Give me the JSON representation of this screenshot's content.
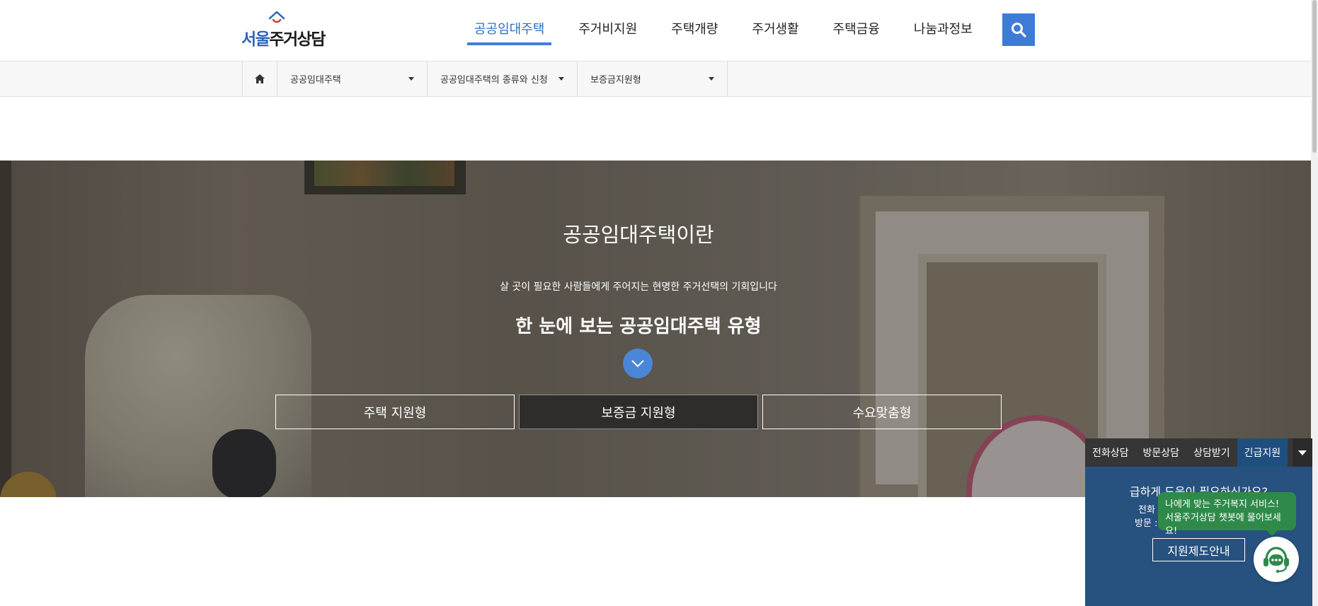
{
  "header": {
    "logo_text_part1": "서울",
    "logo_text_part2": "주거상담",
    "nav": [
      {
        "label": "공공임대주택",
        "active": true
      },
      {
        "label": "주거비지원"
      },
      {
        "label": "주택개량"
      },
      {
        "label": "주거생활"
      },
      {
        "label": "주택금융"
      },
      {
        "label": "나눔과정보"
      }
    ],
    "search_icon": "search-icon",
    "accent_color": "#3e7bd6"
  },
  "breadcrumb": {
    "home_icon": "home-icon",
    "items": [
      {
        "label": "공공임대주택"
      },
      {
        "label": "공공임대주택의 종류와 신청"
      },
      {
        "label": "보증금지원형"
      }
    ]
  },
  "hero": {
    "title": "공공임대주택이란",
    "subtitle": "살 곳이 필요한 사람들에게 주어지는 현명한 주거선택의 기회입니다",
    "headline": "한 눈에 보는 공공임대주택 유형",
    "tabs": [
      {
        "label": "주택 지원형"
      },
      {
        "label": "보증금 지원형",
        "active": true
      },
      {
        "label": "수요맞춤형"
      }
    ]
  },
  "consult": {
    "tabs": [
      {
        "label": "전화상담"
      },
      {
        "label": "방문상담"
      },
      {
        "label": "상담받기"
      },
      {
        "label": "긴급지원",
        "active": true
      }
    ],
    "question": "급하게 도움이 필요하신가요?",
    "phone_prefix": "전화",
    "visit_prefix": "방문 :",
    "guide_button": "지원제도안내"
  },
  "chatbot": {
    "line1": "나에게 맞는 주거복지 서비스!",
    "line2": "서울주거상담 챗봇에 물어보세요!",
    "icon": "chatbot-headset-icon",
    "color": "#2f8a4a"
  }
}
